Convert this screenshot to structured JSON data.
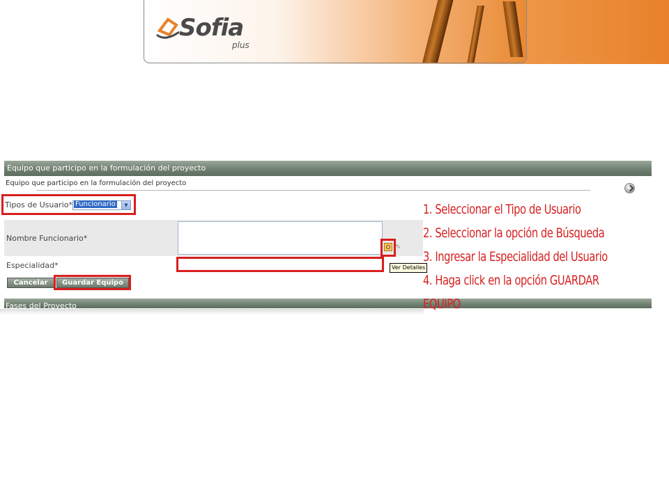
{
  "banner": {
    "logo_text": "Sofia",
    "logo_sub": "plus"
  },
  "panel": {
    "title": "Equipo que participo en la formulación del proyecto",
    "subtitle": "Equipo que participo en la formulación del proyecto",
    "tipos_label": "Tipos de Usuario*",
    "tipos_selected": "Funcionario",
    "nombre_label": "Nombre Funcionario*",
    "especialidad_label": "Especialidad*",
    "tooltip": "Ver Detalles",
    "cancel_label": "Cancelar",
    "save_label": "Guardar Equipo",
    "section2_title": "Fases del Proyecto"
  },
  "instructions": [
    "1. Seleccionar el Tipo de Usuario",
    "2. Seleccionar la opción de Búsqueda",
    "3. Ingresar la Especialidad del Usuario",
    "4. Haga click en la opción GUARDAR",
    "EQUIPO"
  ],
  "colors": {
    "highlight": "#d81e1e",
    "header_bar": "#6f7f70",
    "brand_orange": "#e8812a"
  }
}
